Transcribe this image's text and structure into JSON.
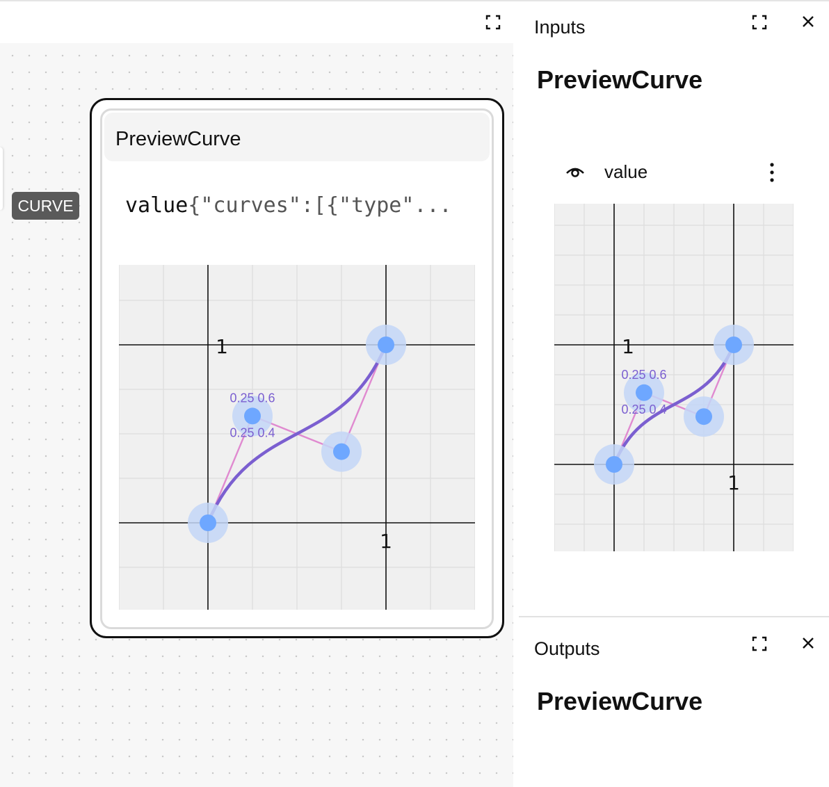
{
  "graph": {
    "input_type_badge": "CURVE",
    "node": {
      "title": "PreviewCurve",
      "port_name": "value",
      "port_value": "{\"curves\":[{\"type\"..."
    }
  },
  "inputs_panel": {
    "label": "Inputs",
    "title": "PreviewCurve",
    "field_label": "value",
    "icons": [
      "expand-icon",
      "close-icon",
      "eye-icon",
      "more-vertical-icon"
    ]
  },
  "outputs_panel": {
    "label": "Outputs",
    "title": "PreviewCurve",
    "icons": [
      "expand-icon",
      "close-icon"
    ]
  },
  "colors": {
    "curve": "#7b5fd0",
    "handle_line": "#e08ad0",
    "point": "#6ea7ff",
    "point_halo": "#c3d6f7",
    "label": "#7b5fd0",
    "port_ring": "#6b2368",
    "badge": "#5a5a5a"
  },
  "chart_data": {
    "type": "line",
    "description_kind": "cubic bezier curve editor",
    "tick_labels": {
      "x": "1",
      "y": "1"
    },
    "anchors": [
      {
        "x": 0,
        "y": 0
      },
      {
        "x": 1,
        "y": 1
      }
    ],
    "control_points": [
      {
        "x": 0.25,
        "y": 0.6
      },
      {
        "x": 0.75,
        "y": 0.4
      }
    ],
    "point_labels": [
      "0.25 0.6",
      "0.25 0.4"
    ]
  }
}
